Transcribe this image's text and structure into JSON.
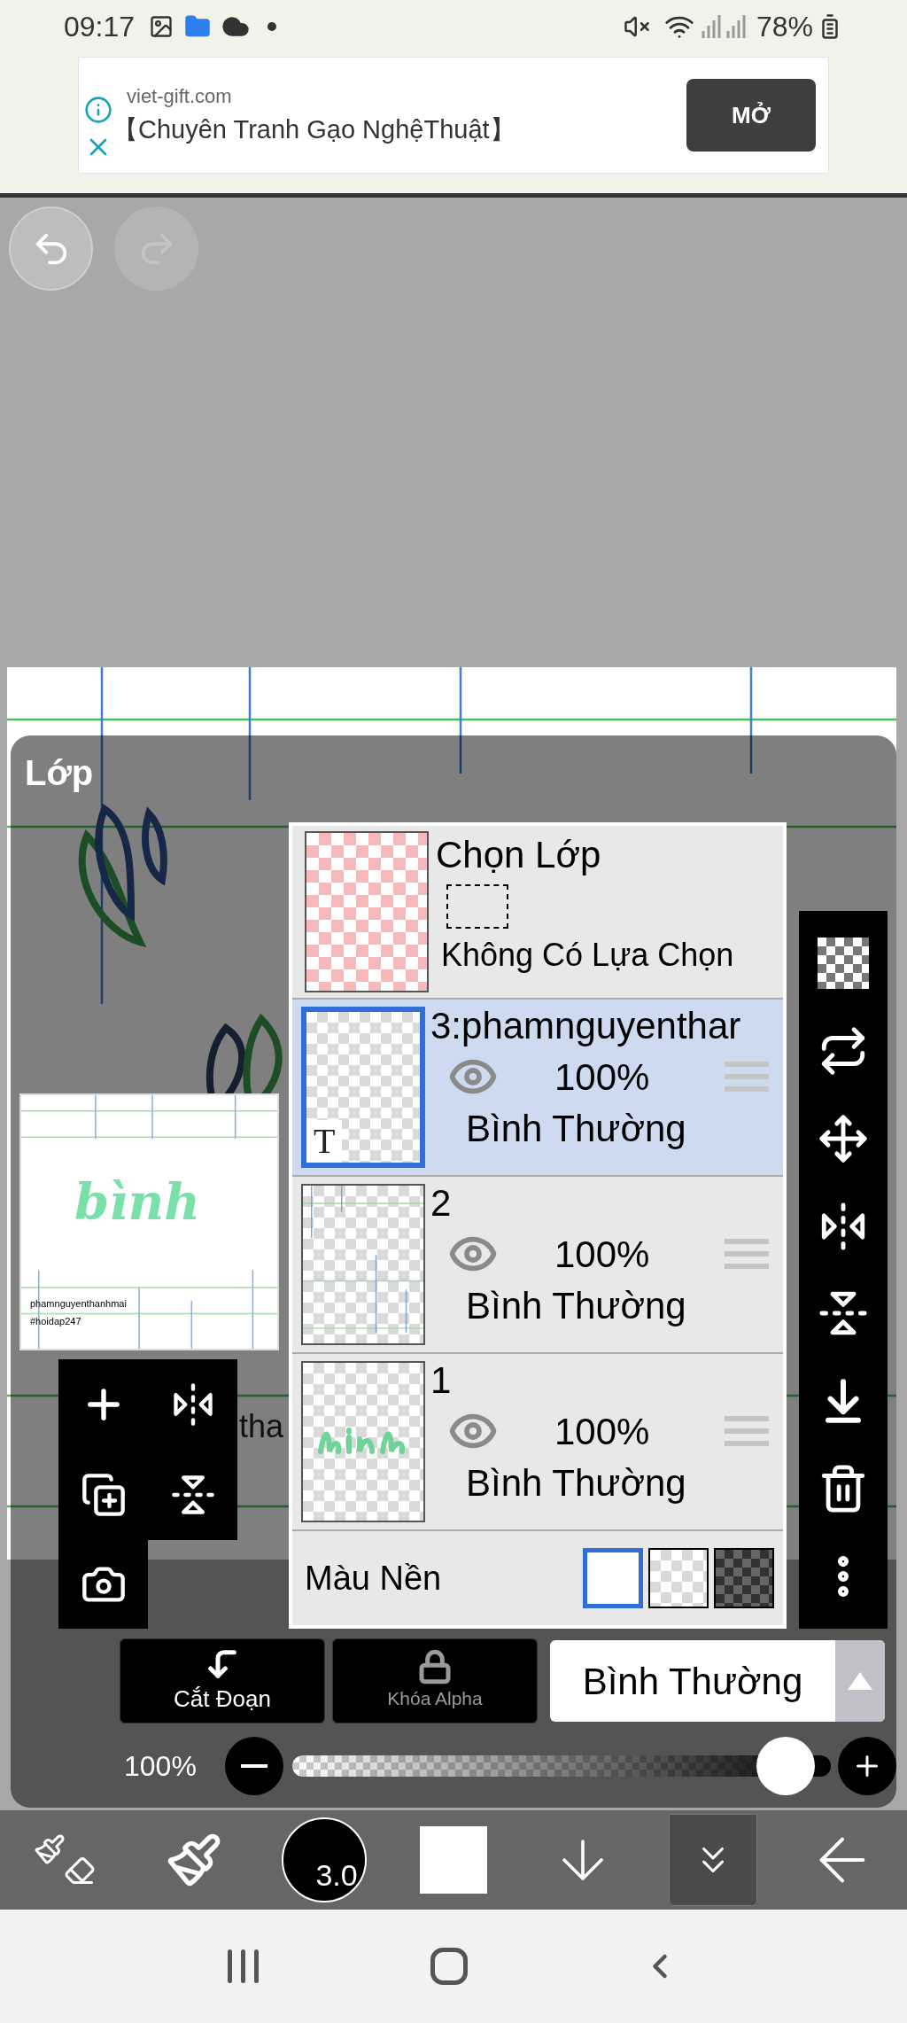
{
  "status_bar": {
    "time": "09:17",
    "battery": "78%"
  },
  "ad": {
    "domain": "viet-gift.com",
    "title": "【Chuyên Tranh Gạo NghệThuật】",
    "button": "MỞ"
  },
  "canvas": {
    "text": "tha"
  },
  "layer_panel": {
    "title": "Lớp",
    "preview": {
      "art_text": "bình",
      "caption": [
        "phamnguyenthanhmai",
        "#hoidap247"
      ]
    },
    "selection_layer": {
      "title": "Chọn Lớp",
      "status": "Không Có Lựa Chọn"
    },
    "layers": [
      {
        "name": "3:phamnguyenthar",
        "kind": "text",
        "badge": "T",
        "visible": true,
        "opacity": "100%",
        "blend": "Bình Thường",
        "selected": true
      },
      {
        "name": "2",
        "kind": "lines",
        "visible": true,
        "opacity": "100%",
        "blend": "Bình Thường",
        "selected": false
      },
      {
        "name": "1",
        "kind": "art",
        "visible": true,
        "opacity": "100%",
        "blend": "Bình Thường",
        "selected": false
      }
    ],
    "background": {
      "label": "Màu Nền",
      "options": [
        {
          "kind": "white",
          "selected": true
        },
        {
          "kind": "transparent",
          "selected": false
        },
        {
          "kind": "dark",
          "selected": false
        }
      ]
    },
    "clip_button": "Cắt Đoạn",
    "alpha_lock": {
      "label": "Khóa Alpha",
      "on": false
    },
    "blend_mode": "Bình Thường",
    "opacity": {
      "reading": "100%",
      "level": 1.0
    }
  },
  "bottom_toolbar": {
    "items": [
      {
        "kind": "swap",
        "selected": false
      },
      {
        "kind": "brush",
        "selected": false
      },
      {
        "kind": "size",
        "label": "3.0",
        "selected": false
      },
      {
        "kind": "color",
        "selected": false
      },
      {
        "kind": "down",
        "selected": false
      },
      {
        "kind": "collapse",
        "selected": true
      },
      {
        "kind": "back",
        "selected": false
      }
    ]
  }
}
